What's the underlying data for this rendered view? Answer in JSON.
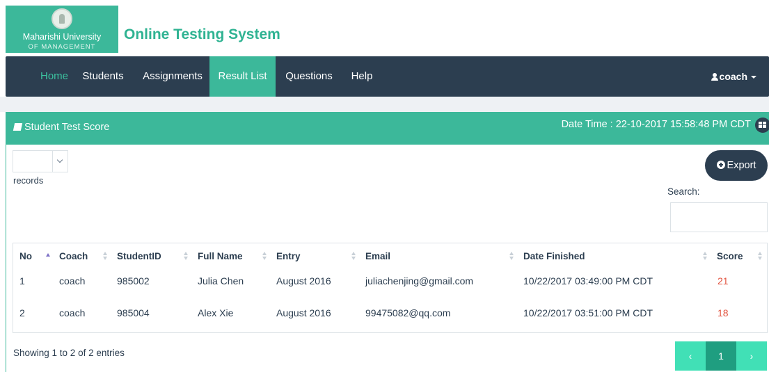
{
  "header": {
    "logo_university": "Maharishi University",
    "logo_subtitle": "OF MANAGEMENT",
    "app_title": "Online Testing System"
  },
  "nav": {
    "items": [
      {
        "label": "Home"
      },
      {
        "label": "Students"
      },
      {
        "label": "Assignments"
      },
      {
        "label": "Result List"
      },
      {
        "label": "Questions"
      },
      {
        "label": "Help"
      }
    ],
    "active": "Result List",
    "user": "coach"
  },
  "panel": {
    "title": "Student Test Score",
    "datetime": "Date Time : 22-10-2017 15:58:48 PM CDT"
  },
  "controls": {
    "records_label": "records",
    "length_value": "",
    "export_label": "Export",
    "search_label": "Search:",
    "search_value": ""
  },
  "table": {
    "columns": [
      "No",
      "Coach",
      "StudentID",
      "Full Name",
      "Entry",
      "Email",
      "Date Finished",
      "Score"
    ],
    "rows": [
      [
        "1",
        "coach",
        "985002",
        "Julia Chen",
        "August 2016",
        "juliachenjing@gmail.com",
        "10/22/2017 03:49:00 PM CDT",
        "21"
      ],
      [
        "2",
        "coach",
        "985004",
        "Alex Xie",
        "August 2016",
        "99475082@qq.com",
        "10/22/2017 03:51:00 PM CDT",
        "18"
      ]
    ]
  },
  "footer": {
    "info": "Showing 1 to 2 of 2 entries",
    "prev": "‹",
    "page": "1",
    "next": "›"
  },
  "colors": {
    "navbar": "#2c3e50",
    "accent": "#3cb89a",
    "score": "#e2533f",
    "pager": "#41e0b6"
  }
}
